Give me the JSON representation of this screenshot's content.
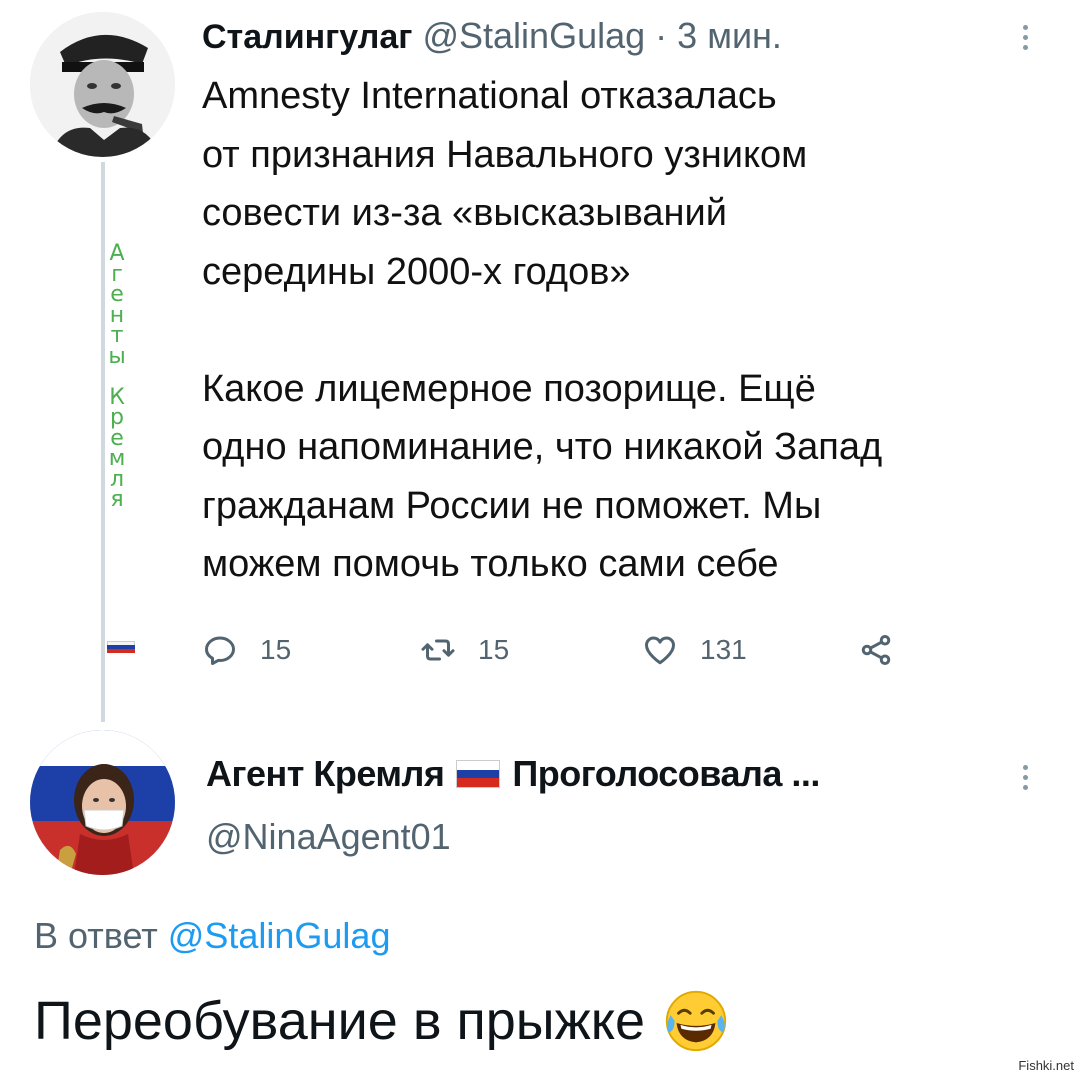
{
  "tweet1": {
    "author_name": "Сталингулаг",
    "author_handle": "@StalinGulag",
    "separator": "·",
    "time": "3 мин.",
    "body_lines": [
      "Amnesty International отказалась",
      "от признания Навального узником",
      "совести из-за «высказываний",
      "середины 2000-х годов»",
      "",
      "Какое лицемерное позорище. Ещё",
      "одно напоминание, что никакой Запад",
      "гражданам России не поможет. Мы",
      "можем помочь только сами себе"
    ],
    "thread_label_chars": [
      "А",
      "г",
      "е",
      "н",
      "т",
      "ы",
      "",
      "К",
      "р",
      "е",
      "м",
      "л",
      "я"
    ],
    "stats": {
      "replies": "15",
      "retweets": "15",
      "likes": "131"
    },
    "icons": {
      "reply": "reply-icon",
      "retweet": "retweet-icon",
      "like": "heart-icon",
      "share": "share-icon",
      "more": "more-vertical-icon"
    }
  },
  "tweet2": {
    "author_name_part1": "Агент Кремля",
    "author_name_part2": "Проголосовала ...",
    "author_handle": "@NinaAgent01",
    "reply_prefix": "В ответ",
    "reply_to": "@StalinGulag",
    "text": "Переобувание в прыжке",
    "emoji": "face-with-tears-of-joy-icon"
  },
  "flag_colors": [
    "#ffffff",
    "#1c3fa8",
    "#d52b1e"
  ],
  "accent_color": "#1d9bf0",
  "watermark": "Fishki.net"
}
